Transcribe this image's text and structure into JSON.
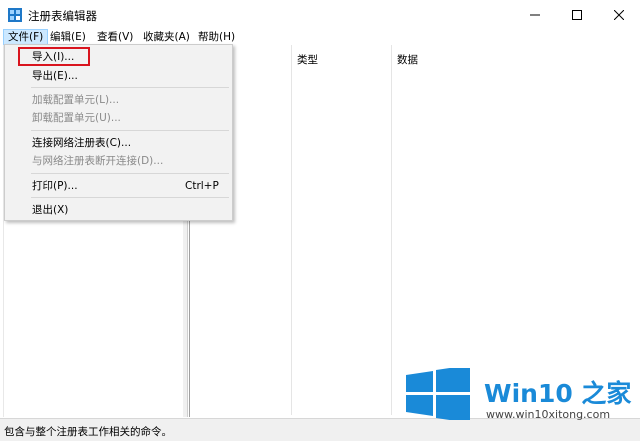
{
  "window": {
    "title": "注册表编辑器"
  },
  "menubar": {
    "items": [
      {
        "label": "文件(F)"
      },
      {
        "label": "编辑(E)"
      },
      {
        "label": "查看(V)"
      },
      {
        "label": "收藏夹(A)"
      },
      {
        "label": "帮助(H)"
      }
    ]
  },
  "file_menu": {
    "items": [
      {
        "label": "导入(I)...",
        "enabled": true,
        "highlighted_box": true
      },
      {
        "label": "导出(E)...",
        "enabled": true
      },
      {
        "label": "加载配置单元(L)...",
        "enabled": false
      },
      {
        "label": "卸载配置单元(U)...",
        "enabled": false
      },
      {
        "label": "连接网络注册表(C)...",
        "enabled": true
      },
      {
        "label": "与网络注册表断开连接(D)...",
        "enabled": false
      },
      {
        "label": "打印(P)...",
        "enabled": true,
        "shortcut": "Ctrl+P"
      },
      {
        "label": "退出(X)",
        "enabled": true
      }
    ],
    "highlight_color": "#d9141e"
  },
  "list": {
    "columns": [
      {
        "label": ""
      },
      {
        "label": "类型"
      },
      {
        "label": "数据"
      }
    ]
  },
  "statusbar": {
    "text": "包含与整个注册表工作相关的命令。"
  },
  "watermark": {
    "title": "Win10 之家",
    "url": "www.win10xitong.com",
    "brand_color": "#1a8ad8"
  },
  "window_controls": {
    "minimize_icon": "minimize-icon",
    "maximize_icon": "maximize-icon",
    "close_icon": "close-icon"
  }
}
